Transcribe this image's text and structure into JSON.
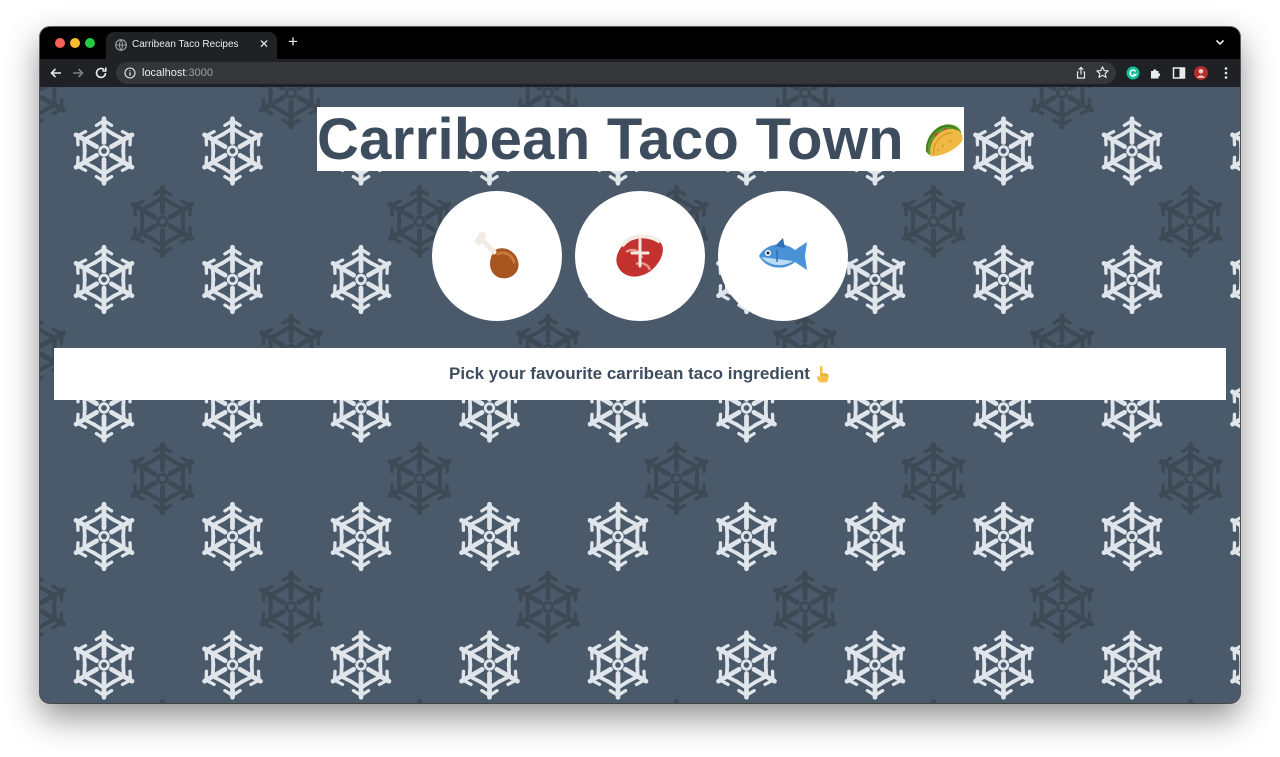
{
  "browser": {
    "tab": {
      "title": "Carribean Taco Recipes"
    },
    "address_bar": {
      "url_host": "localhost",
      "url_port": ":3000"
    }
  },
  "page": {
    "title": "Carribean Taco Town",
    "title_icon": "taco-icon",
    "ingredients": [
      {
        "icon": "poultry-leg-icon",
        "name": "chicken"
      },
      {
        "icon": "meat-cut-icon",
        "name": "beef"
      },
      {
        "icon": "fish-icon",
        "name": "fish"
      }
    ],
    "prompt": "Pick your favourite carribean taco ingredient",
    "prompt_icon": "pointing-up-hand-icon",
    "colors": {
      "background": "#4a5a6a",
      "text": "#3d4d5e",
      "snowflake_light": "#dfe5ea",
      "snowflake_dark": "#3a4650"
    }
  }
}
